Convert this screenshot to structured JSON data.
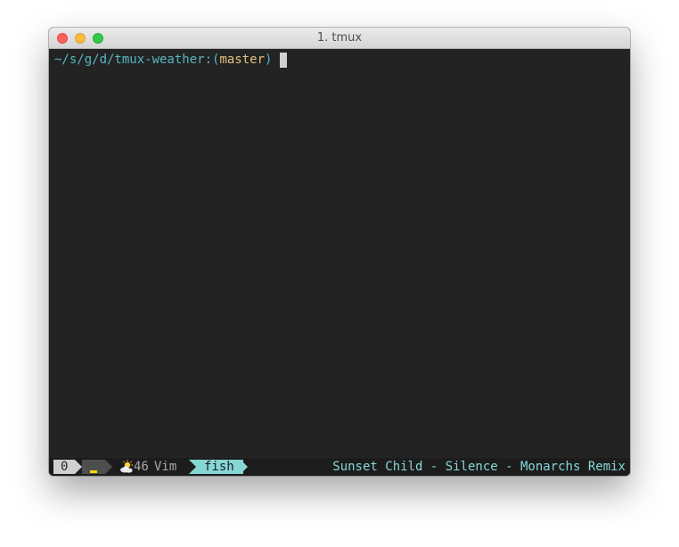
{
  "window": {
    "title": "1. tmux"
  },
  "prompt": {
    "path": "~/s/g/d/tmux-weather:",
    "open_paren": "(",
    "branch": "master",
    "close_paren": ")"
  },
  "statusbar": {
    "session": "0",
    "weather_icon": "partly-cloudy-icon",
    "temperature": "46",
    "window_inactive": "Vim",
    "window_active": "fish",
    "now_playing": "Sunset Child - Silence - Monarchs Remix"
  },
  "colors": {
    "path": "#56b6c2",
    "branch": "#e5c07b",
    "active_window_bg": "#87d7d7",
    "status_bg": "#1c1c1c",
    "terminal_bg": "#232323"
  }
}
